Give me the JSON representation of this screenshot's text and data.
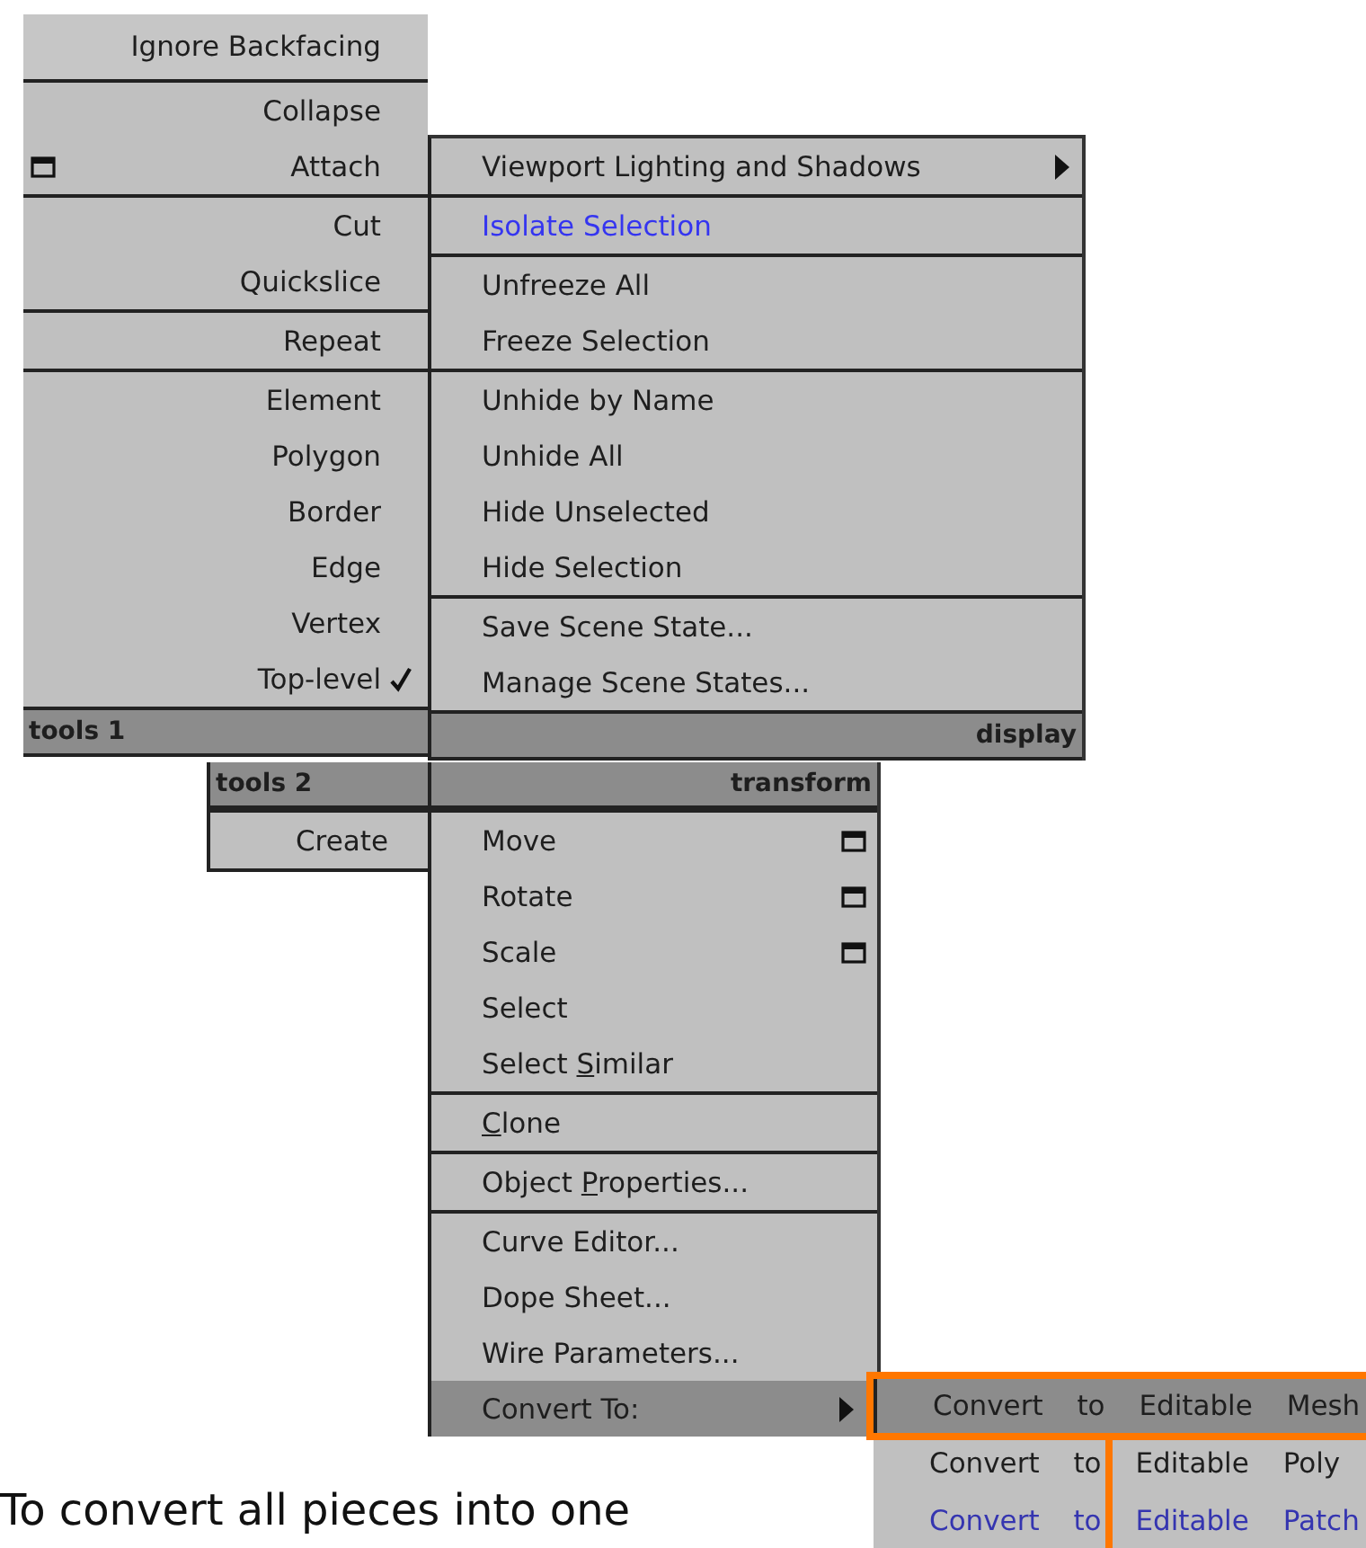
{
  "quad_menu": {
    "panels": [
      {
        "title": "tools 1",
        "sections": [
          [
            {
              "label": "Ignore Backfacing",
              "checked": false,
              "options": false
            }
          ],
          [
            {
              "label": "Collapse",
              "checked": false,
              "options": false
            },
            {
              "label": "Attach",
              "checked": false,
              "options": true
            }
          ],
          [
            {
              "label": "Cut",
              "checked": false,
              "options": false
            },
            {
              "label": "Quickslice",
              "checked": false,
              "options": false
            }
          ],
          [
            {
              "label": "Repeat",
              "checked": false,
              "options": false
            }
          ],
          [
            {
              "label": "Element",
              "checked": false,
              "options": false
            },
            {
              "label": "Polygon",
              "checked": false,
              "options": false
            },
            {
              "label": "Border",
              "checked": false,
              "options": false
            },
            {
              "label": "Edge",
              "checked": false,
              "options": false
            },
            {
              "label": "Vertex",
              "checked": false,
              "options": false
            },
            {
              "label": "Top-level",
              "checked": true,
              "options": false
            }
          ]
        ]
      },
      {
        "title": "display",
        "sections": [
          [
            {
              "label": "Viewport Lighting and Shadows",
              "submenu": true
            }
          ],
          [
            {
              "label": "Isolate Selection",
              "submenu": false,
              "color": "#3535f0"
            }
          ],
          [
            {
              "label": "Unfreeze All",
              "submenu": false
            },
            {
              "label": "Freeze Selection",
              "submenu": false
            }
          ],
          [
            {
              "label": "Unhide by Name",
              "submenu": false
            },
            {
              "label": "Unhide All",
              "submenu": false
            },
            {
              "label": "Hide Unselected",
              "submenu": false
            },
            {
              "label": "Hide Selection",
              "submenu": false
            }
          ],
          [
            {
              "label": "Save Scene State...",
              "submenu": false
            },
            {
              "label": "Manage Scene States...",
              "submenu": false
            }
          ]
        ]
      },
      {
        "title": "tools 2",
        "sections": [
          [
            {
              "label": "Create"
            }
          ]
        ]
      },
      {
        "title": "transform",
        "sections": [
          [
            {
              "label": "Move",
              "options": true,
              "submenu": false,
              "selected": false
            },
            {
              "label": "Rotate",
              "options": true,
              "submenu": false,
              "selected": false
            },
            {
              "label": "Scale",
              "options": true,
              "submenu": false,
              "selected": false
            },
            {
              "label": "Select",
              "options": false,
              "submenu": false,
              "selected": false
            },
            {
              "label": {
                "before": "Select ",
                "key": "S",
                "after": "imilar"
              },
              "options": false,
              "submenu": false,
              "selected": false
            }
          ],
          [
            {
              "label": {
                "key": "C",
                "after": "lone"
              },
              "options": false,
              "submenu": false,
              "selected": false
            }
          ],
          [
            {
              "label": {
                "before": "Object ",
                "key": "P",
                "after": "roperties..."
              },
              "options": false,
              "submenu": false,
              "selected": false
            }
          ],
          [
            {
              "label": "Curve Editor...",
              "options": false,
              "submenu": false,
              "selected": false
            },
            {
              "label": "Dope Sheet...",
              "options": false,
              "submenu": false,
              "selected": false
            },
            {
              "label": "Wire Parameters...",
              "options": false,
              "submenu": false,
              "selected": false
            },
            {
              "label": "Convert To:",
              "options": false,
              "submenu": true,
              "selected": true
            }
          ]
        ]
      }
    ]
  },
  "submenu": {
    "items": [
      {
        "label": "Convert to Editable Mesh",
        "selected": true
      },
      {
        "label": "Convert to Editable Poly",
        "selected": false
      },
      {
        "label": "Convert to Editable Patch",
        "selected": false,
        "color": "#3535b0"
      }
    ]
  },
  "caption": "To convert all pieces into one"
}
